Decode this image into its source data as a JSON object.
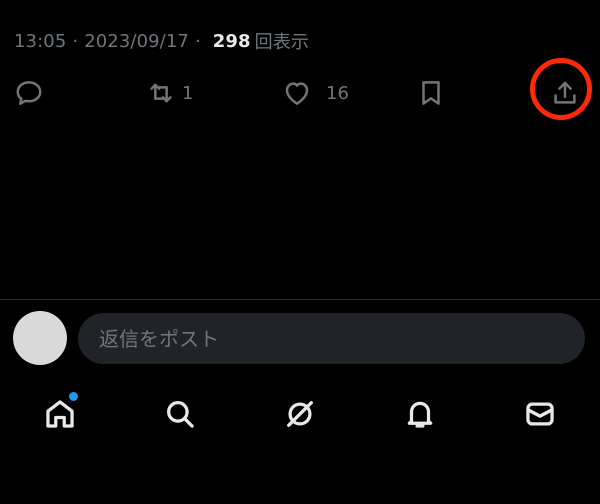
{
  "tweet_meta": {
    "time": "13:05",
    "date": "2023/09/17",
    "separator": "·",
    "views_count": "298",
    "views_label": "回表示"
  },
  "actions": {
    "reply": {
      "icon": "reply-icon"
    },
    "repost": {
      "icon": "repost-icon",
      "count": "1"
    },
    "like": {
      "icon": "heart-icon",
      "count": "16"
    },
    "bookmark": {
      "icon": "bookmark-icon"
    },
    "share": {
      "icon": "share-icon",
      "highlight_color": "#ff2a05"
    }
  },
  "reply_box": {
    "placeholder": "返信をポスト"
  },
  "bottom_nav": {
    "items": [
      "home-icon",
      "search-icon",
      "grok-icon",
      "notifications-icon",
      "messages-icon"
    ],
    "home_has_notification_dot": true,
    "dot_color": "#1d9bf0"
  },
  "colors": {
    "background": "#000000",
    "muted": "#71767b",
    "text": "#e7e9ea",
    "input_bg": "#202327"
  }
}
